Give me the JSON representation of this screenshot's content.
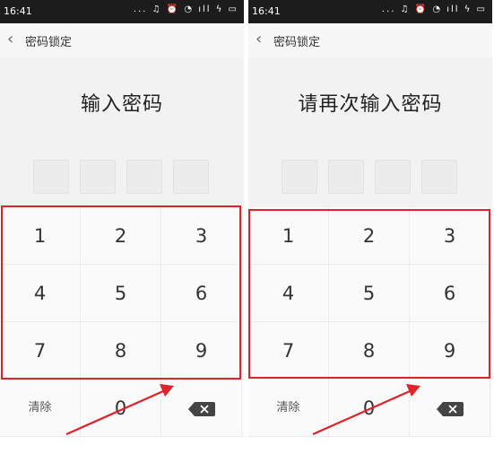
{
  "screens": [
    {
      "status": {
        "time": "16:41",
        "icons": "... ♫ ⏰ ◔ ıll ϟ ▭"
      },
      "header": {
        "back": "‹",
        "title": "密码锁定"
      },
      "prompt": "输入密码",
      "keys": [
        "1",
        "2",
        "3",
        "4",
        "5",
        "6",
        "7",
        "8",
        "9"
      ],
      "clear_label": "清除",
      "zero": "0",
      "delete_icon": "backspace-icon"
    },
    {
      "status": {
        "time": "16:41",
        "icons": "... ♫ ⏰ ◔ ıll ϟ ▭"
      },
      "header": {
        "back": "‹",
        "title": "密码锁定"
      },
      "prompt": "请再次输入密码",
      "keys": [
        "1",
        "2",
        "3",
        "4",
        "5",
        "6",
        "7",
        "8",
        "9"
      ],
      "clear_label": "清除",
      "zero": "0",
      "delete_icon": "backspace-icon"
    }
  ],
  "colors": {
    "highlight": "#e0222a",
    "background": "#f2f2f2",
    "statusbar": "#1c1c1c"
  }
}
